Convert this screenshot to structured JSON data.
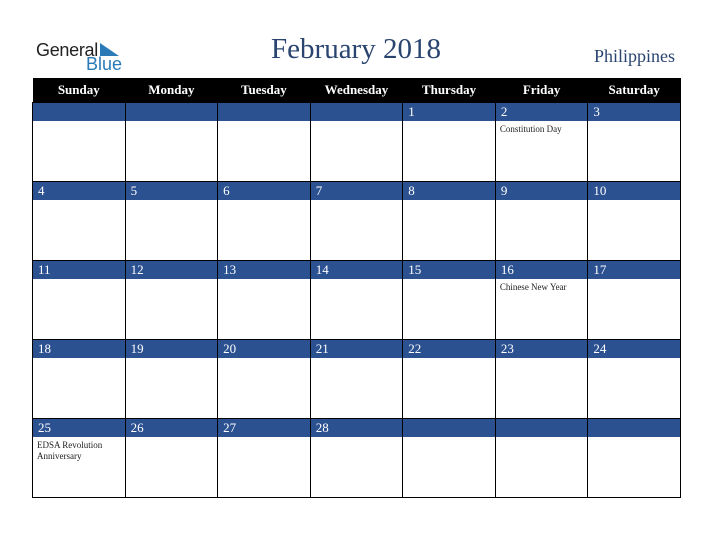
{
  "logo": {
    "line1": "General",
    "line2": "Blue",
    "icon": "triangle-flag-icon"
  },
  "title": "February 2018",
  "country": "Philippines",
  "colors": {
    "header_bg": "#000000",
    "band_bg": "#2c5191",
    "title": "#2a4470",
    "logo_blue": "#2a7ab8"
  },
  "weekdays": [
    "Sunday",
    "Monday",
    "Tuesday",
    "Wednesday",
    "Thursday",
    "Friday",
    "Saturday"
  ],
  "weeks": [
    [
      {
        "day": "",
        "event": ""
      },
      {
        "day": "",
        "event": ""
      },
      {
        "day": "",
        "event": ""
      },
      {
        "day": "",
        "event": ""
      },
      {
        "day": "1",
        "event": ""
      },
      {
        "day": "2",
        "event": "Constitution Day"
      },
      {
        "day": "3",
        "event": ""
      }
    ],
    [
      {
        "day": "4",
        "event": ""
      },
      {
        "day": "5",
        "event": ""
      },
      {
        "day": "6",
        "event": ""
      },
      {
        "day": "7",
        "event": ""
      },
      {
        "day": "8",
        "event": ""
      },
      {
        "day": "9",
        "event": ""
      },
      {
        "day": "10",
        "event": ""
      }
    ],
    [
      {
        "day": "11",
        "event": ""
      },
      {
        "day": "12",
        "event": ""
      },
      {
        "day": "13",
        "event": ""
      },
      {
        "day": "14",
        "event": ""
      },
      {
        "day": "15",
        "event": ""
      },
      {
        "day": "16",
        "event": "Chinese New Year"
      },
      {
        "day": "17",
        "event": ""
      }
    ],
    [
      {
        "day": "18",
        "event": ""
      },
      {
        "day": "19",
        "event": ""
      },
      {
        "day": "20",
        "event": ""
      },
      {
        "day": "21",
        "event": ""
      },
      {
        "day": "22",
        "event": ""
      },
      {
        "day": "23",
        "event": ""
      },
      {
        "day": "24",
        "event": ""
      }
    ],
    [
      {
        "day": "25",
        "event": "EDSA Revolution Anniversary"
      },
      {
        "day": "26",
        "event": ""
      },
      {
        "day": "27",
        "event": ""
      },
      {
        "day": "28",
        "event": ""
      },
      {
        "day": "",
        "event": ""
      },
      {
        "day": "",
        "event": ""
      },
      {
        "day": "",
        "event": ""
      }
    ]
  ]
}
